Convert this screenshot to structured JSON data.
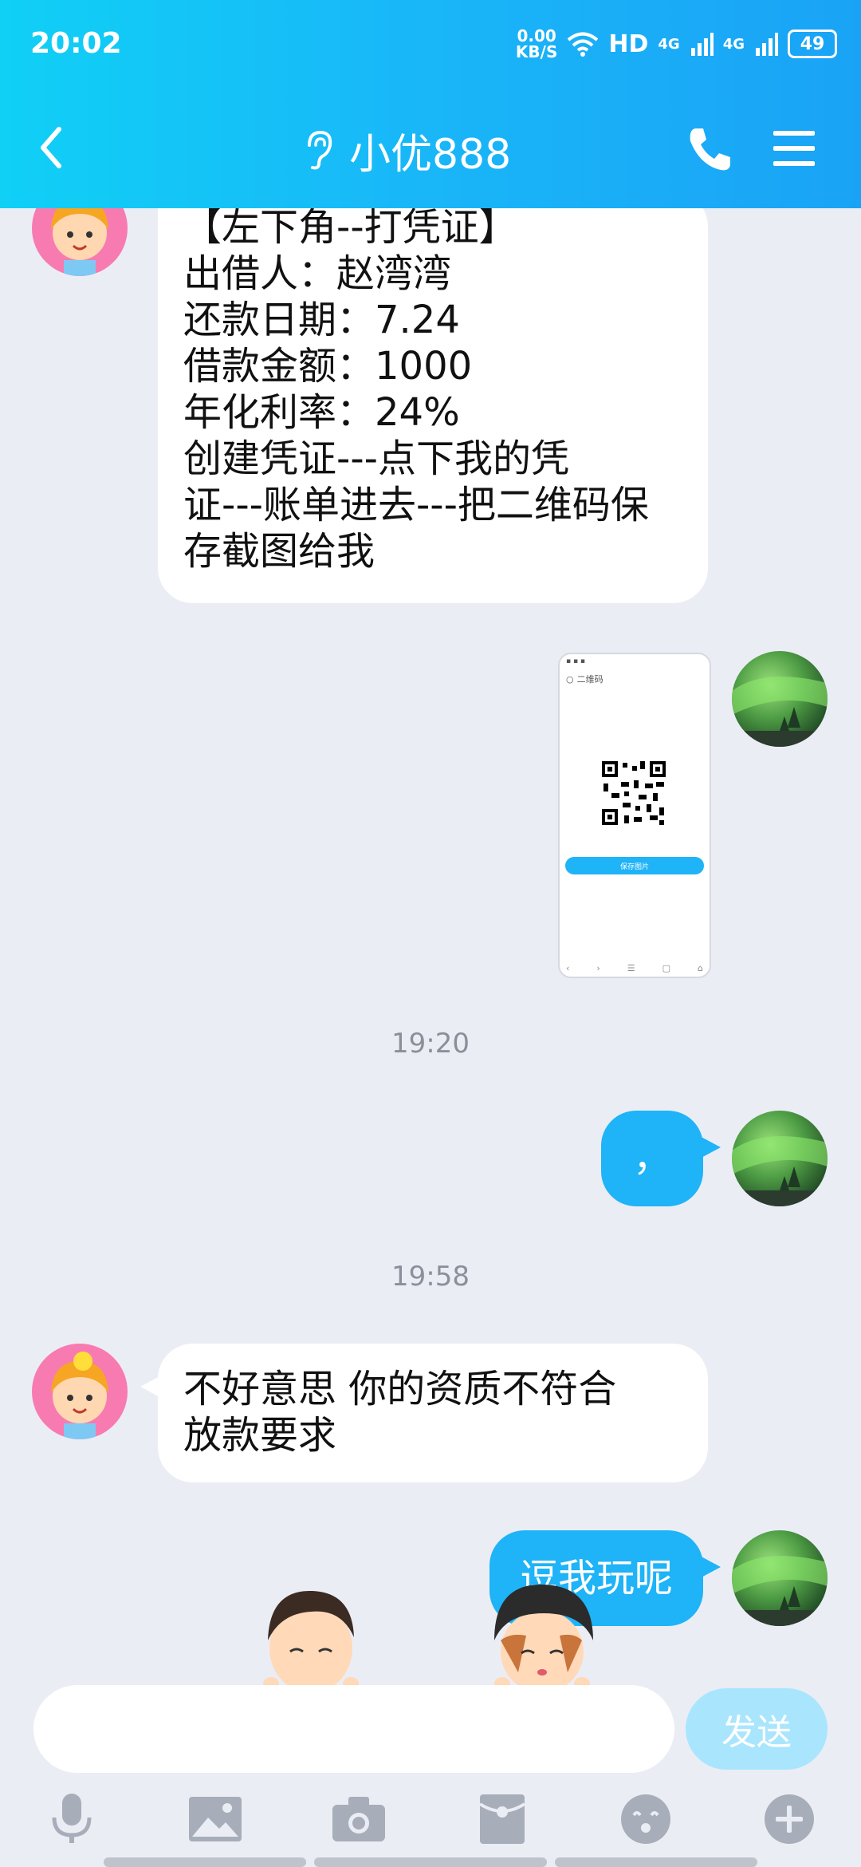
{
  "status_bar": {
    "time": "20:02",
    "net_speed_value": "0.00",
    "net_speed_unit": "KB/S",
    "hd": "HD",
    "sig1": "4G",
    "sig2": "4G",
    "battery": "49"
  },
  "header": {
    "title": "小优888"
  },
  "messages": {
    "m1_lines": [
      "【左下角--打凭证】",
      "出借人：赵湾湾",
      "还款日期：7.24",
      "借款金额：1000",
      "年化利率：24%",
      "创建凭证---点下我的凭",
      "证---账单进去---把二维码保",
      "存截图给我"
    ],
    "time1": "19:20",
    "m3": "，",
    "time2": "19:58",
    "m4_lines": [
      "不好意思  你的资质不符合",
      "放款要求"
    ],
    "m5": "逗我玩呢"
  },
  "screenshot_thumb": {
    "search_text": "二维码",
    "button_text": "保存图片"
  },
  "input": {
    "value": "",
    "send_label": "发送"
  },
  "colors": {
    "header_gradient_start": "#10d0f6",
    "header_gradient_end": "#1aa3f6",
    "outgoing_bubble": "#1fb3f7",
    "send_button_disabled": "#a9e6fd",
    "background": "#ebedf5"
  },
  "icons": [
    "back-arrow-icon",
    "ear-icon",
    "phone-icon",
    "menu-icon",
    "microphone-icon",
    "image-icon",
    "camera-icon",
    "red-packet-icon",
    "emoji-icon",
    "plus-icon"
  ]
}
